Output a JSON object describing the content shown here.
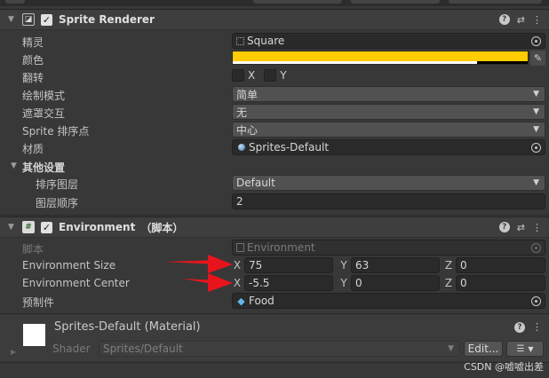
{
  "sprite_renderer": {
    "title": "Sprite Renderer",
    "sprite_label": "精灵",
    "sprite_value": "Square",
    "color_label": "颜色",
    "color_value": "#ffcc00",
    "flip_label": "翻转",
    "flip_x": "X",
    "flip_y": "Y",
    "draw_mode_label": "绘制模式",
    "draw_mode_value": "简单",
    "mask_label": "遮罩交互",
    "mask_value": "无",
    "sort_point_label": "Sprite 排序点",
    "sort_point_value": "中心",
    "material_label": "材质",
    "material_value": "Sprites-Default",
    "other_settings_label": "其他设置",
    "sorting_layer_label": "排序图层",
    "sorting_layer_value": "Default",
    "order_label": "图层顺序",
    "order_value": "2"
  },
  "environment": {
    "title": "Environment",
    "title_suffix": "（脚本）",
    "script_label": "脚本",
    "script_value": "Environment",
    "size_label": "Environment Size",
    "size_x": "75",
    "size_y": "63",
    "size_z": "0",
    "center_label": "Environment Center",
    "center_x": "-5.5",
    "center_y": "0",
    "center_z": "0",
    "prefab_label": "预制件",
    "prefab_value": "Food",
    "axis_x": "X",
    "axis_y": "Y",
    "axis_z": "Z"
  },
  "material": {
    "title": "Sprites-Default (Material)",
    "shader_label": "Shader",
    "shader_value": "Sprites/Default",
    "edit_label": "Edit...",
    "thumb_color": "#ffffff"
  },
  "annotation_color": "#e8141c",
  "watermark": "CSDN @嘘嘘出差"
}
